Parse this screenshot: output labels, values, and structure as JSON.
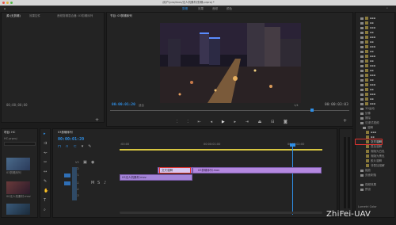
{
  "titlebar": {
    "title": "/用户/pro/docs/无人机素材/剪辑.prproj *"
  },
  "workspaces": [
    "剪辑",
    "效果",
    "音频",
    "颜色"
  ],
  "source": {
    "tabs": [
      "源:(无剪辑)",
      "效果控件",
      "音频剪辑混合器: 03剪辑序列"
    ],
    "timecode": "00;00;00;00",
    "page": "1"
  },
  "program": {
    "tab": "节目: 03剪辑序列",
    "timecode_left": "00:00:01:20",
    "fit": "适合",
    "page": "1/4",
    "timecode_right": "00:00:03:03"
  },
  "project": {
    "tab": "项目: HC",
    "name": "HC.prproj",
    "items": [
      "03剪辑序列",
      "00无人机.mov",
      "01.mov",
      "02.mov"
    ],
    "thumb_labels": [
      "03剪辑序列",
      "00无人机素材.mov"
    ]
  },
  "timeline": {
    "tab": "03剪辑序列",
    "timecode": "00:00:01:20",
    "ruler": [
      ":00:00",
      "00:00:01:00",
      "00:00:02:00"
    ],
    "tracks": [
      "V3",
      "V2",
      "V1",
      "A1",
      "A2",
      "A3"
    ],
    "clips": {
      "v1_label": "交叉溶解",
      "v1_clip": "03剪辑序列.mov",
      "a1_clip": "03无人机素材.mov"
    }
  },
  "effects": {
    "items": [
      "3D运动",
      "划像",
      "擦除",
      "沉浸式视频",
      "溶解",
      "交叉溶解",
      "叠加溶解",
      "渐隐为白色",
      "渐隐为黑色",
      "胶片溶解",
      "非叠加溶解",
      "缩放",
      "页面剥落",
      "视频效果",
      "预设",
      "Lumetri Color"
    ],
    "highlight": "交叉溶解"
  },
  "watermark": "ZhiFei-UAV",
  "colors": {
    "accent": "#2f8fe6",
    "clip_purple": "#b488e0",
    "audio_purple": "#a484d8",
    "highlight_red": "#e0332f"
  }
}
